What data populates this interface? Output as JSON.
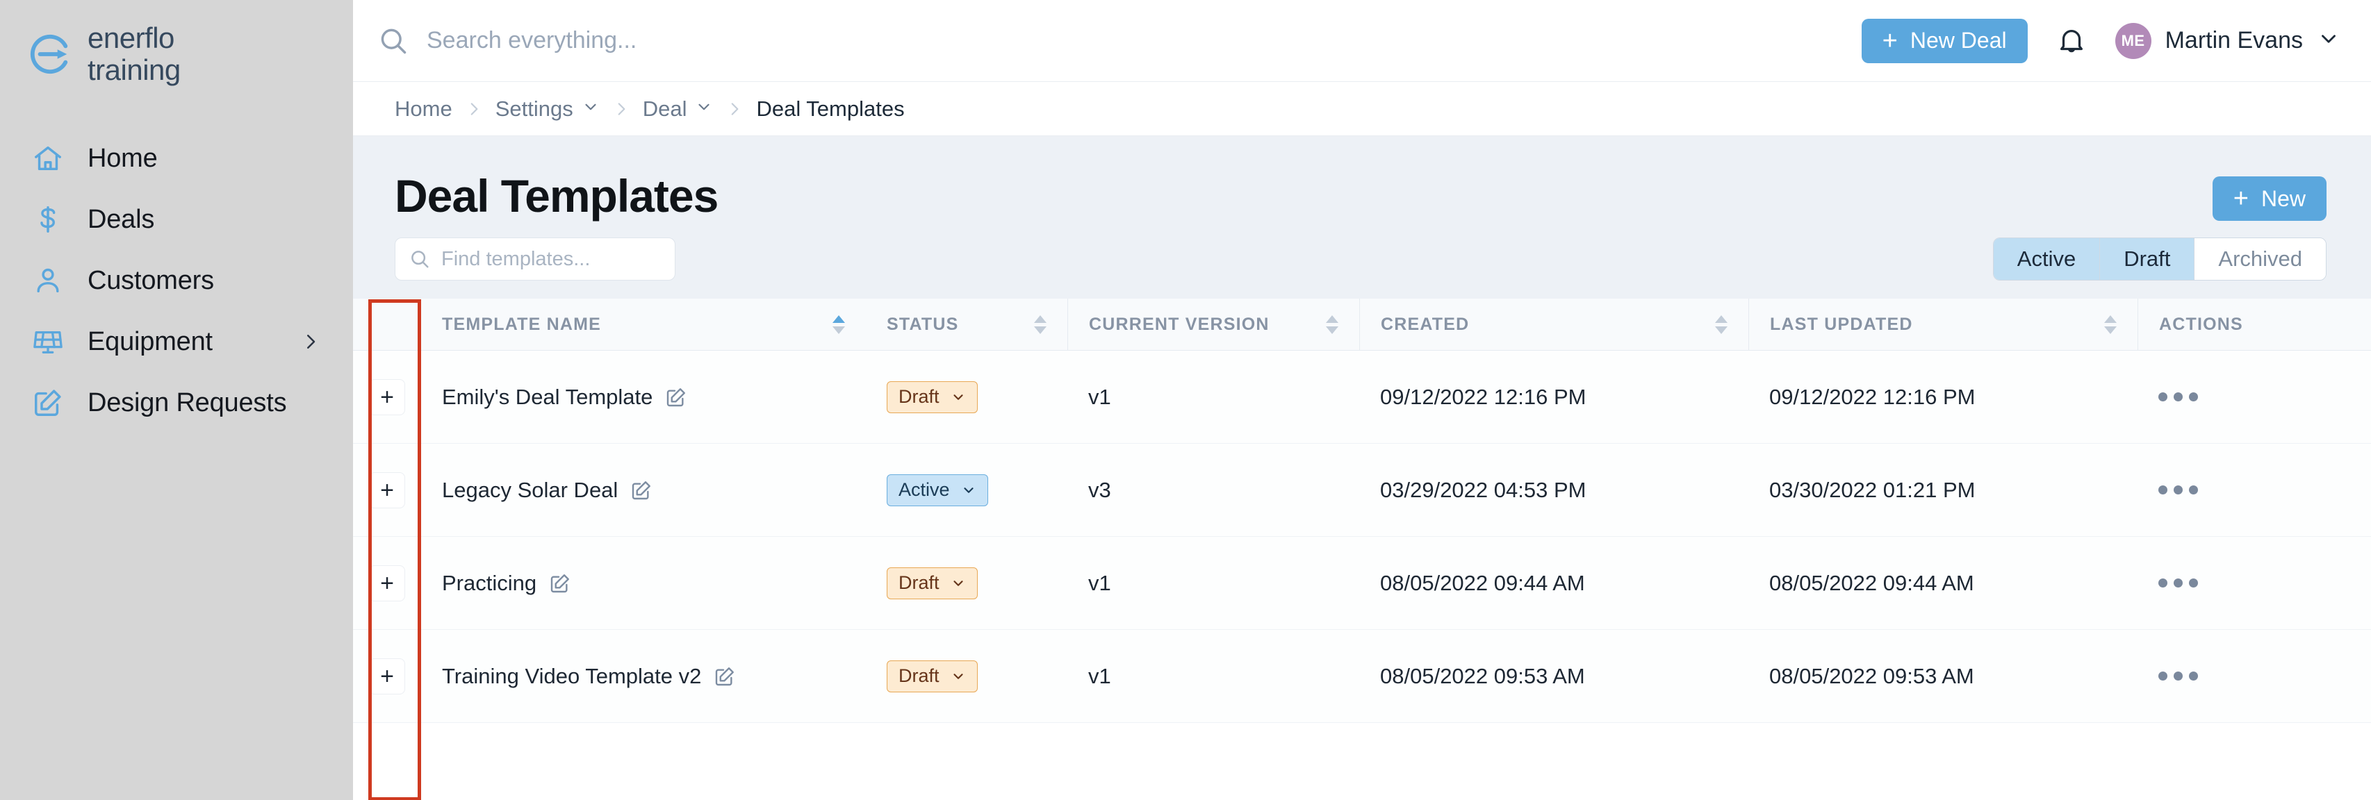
{
  "brand": {
    "line1": "enerflo",
    "line2": "training",
    "logo_icon": "enerflo-logo-icon"
  },
  "sidebar": {
    "items": [
      {
        "label": "Home",
        "icon": "home-icon",
        "has_chevron": false
      },
      {
        "label": "Deals",
        "icon": "dollar-icon",
        "has_chevron": false
      },
      {
        "label": "Customers",
        "icon": "user-icon",
        "has_chevron": false
      },
      {
        "label": "Equipment",
        "icon": "solar-panel-icon",
        "has_chevron": true
      },
      {
        "label": "Design Requests",
        "icon": "pencil-square-icon",
        "has_chevron": false
      }
    ]
  },
  "topbar": {
    "search_placeholder": "Search everything...",
    "search_value": "",
    "search_icon": "search-icon",
    "new_deal_label": "New Deal",
    "new_deal_plus": "+",
    "bell_icon": "bell-icon",
    "avatar_initials": "ME",
    "user_name": "Martin Evans",
    "accent_color": "#5ba7dd",
    "avatar_color": "#b28ab8"
  },
  "breadcrumb": {
    "items": [
      {
        "label": "Home",
        "has_chevron": false,
        "current": false
      },
      {
        "label": "Settings",
        "has_chevron": true,
        "current": false
      },
      {
        "label": "Deal",
        "has_chevron": true,
        "current": false
      },
      {
        "label": "Deal Templates",
        "has_chevron": false,
        "current": true
      }
    ],
    "separator": "›"
  },
  "page": {
    "title": "Deal Templates",
    "new_button_label": "New",
    "new_button_plus": "+"
  },
  "toolbar": {
    "find_placeholder": "Find templates...",
    "find_value": "",
    "find_icon": "search-icon",
    "filters": [
      {
        "label": "Active",
        "selected": true
      },
      {
        "label": "Draft",
        "selected": true
      },
      {
        "label": "Archived",
        "selected": false
      }
    ]
  },
  "table": {
    "columns": [
      {
        "key": "expand",
        "label": "",
        "sortable": false
      },
      {
        "key": "name",
        "label": "TEMPLATE NAME",
        "sortable": true,
        "sort_state": "asc"
      },
      {
        "key": "status",
        "label": "STATUS",
        "sortable": true,
        "sort_state": "none"
      },
      {
        "key": "version",
        "label": "CURRENT VERSION",
        "sortable": true,
        "sort_state": "none"
      },
      {
        "key": "created",
        "label": "CREATED",
        "sortable": true,
        "sort_state": "none"
      },
      {
        "key": "updated",
        "label": "LAST UPDATED",
        "sortable": true,
        "sort_state": "none"
      },
      {
        "key": "actions",
        "label": "ACTIONS",
        "sortable": false
      }
    ],
    "rows": [
      {
        "expand": "+",
        "name": "Emily's Deal Template",
        "edit_icon": "pencil-square-icon",
        "status": "Draft",
        "status_kind": "draft",
        "version": "v1",
        "created": "09/12/2022 12:16 PM",
        "updated": "09/12/2022 12:16 PM",
        "actions_icon": "ellipsis-icon"
      },
      {
        "expand": "+",
        "name": "Legacy Solar Deal",
        "edit_icon": "pencil-square-icon",
        "status": "Active",
        "status_kind": "active",
        "version": "v3",
        "created": "03/29/2022 04:53 PM",
        "updated": "03/30/2022 01:21 PM",
        "actions_icon": "ellipsis-icon"
      },
      {
        "expand": "+",
        "name": "Practicing",
        "edit_icon": "pencil-square-icon",
        "status": "Draft",
        "status_kind": "draft",
        "version": "v1",
        "created": "08/05/2022 09:44 AM",
        "updated": "08/05/2022 09:44 AM",
        "actions_icon": "ellipsis-icon"
      },
      {
        "expand": "+",
        "name": "Training Video Template v2",
        "edit_icon": "pencil-square-icon",
        "status": "Draft",
        "status_kind": "draft",
        "version": "v1",
        "created": "08/05/2022 09:53 AM",
        "updated": "08/05/2022 09:53 AM",
        "actions_icon": "ellipsis-icon"
      }
    ]
  },
  "annotation": {
    "color": "#cf3a20",
    "target": "expand-column"
  }
}
